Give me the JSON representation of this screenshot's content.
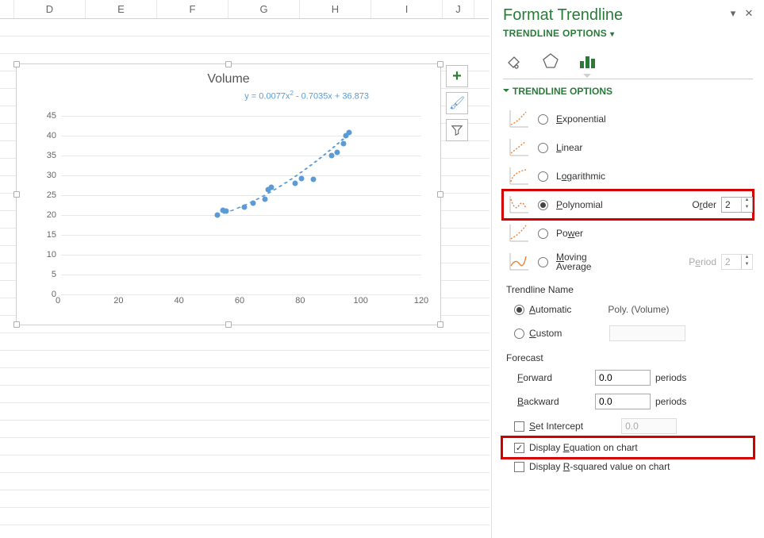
{
  "spreadsheet": {
    "columns": [
      "D",
      "E",
      "F",
      "G",
      "H",
      "I",
      "J"
    ]
  },
  "chart_floating_buttons": {
    "add": "+",
    "styles": "✎",
    "filter": "filter"
  },
  "chart_data": {
    "type": "scatter",
    "title": "Volume",
    "equation_prefix": "y = 0.0077x",
    "equation_mid": " - 0.7035x + 36.873",
    "equation_sup": "2",
    "xlim": [
      0,
      120
    ],
    "ylim": [
      0,
      45
    ],
    "xticks": [
      0,
      20,
      40,
      60,
      80,
      100,
      120
    ],
    "yticks": [
      0,
      5,
      10,
      15,
      20,
      25,
      30,
      35,
      40,
      45
    ],
    "x": [
      52,
      54,
      55,
      61,
      64,
      68,
      69,
      70,
      78,
      80,
      84,
      90,
      92,
      94,
      95,
      96
    ],
    "y": [
      20,
      21.2,
      21,
      22,
      23,
      24,
      26.5,
      27,
      28,
      29.3,
      29,
      35,
      35.8,
      38,
      40,
      40.8
    ],
    "trendline": {
      "type": "polynomial",
      "order": 2,
      "coeffs": [
        0.0077,
        -0.7035,
        36.873
      ]
    }
  },
  "pane": {
    "title": "Format Trendline",
    "subtitle": "TRENDLINE OPTIONS",
    "section": "TRENDLINE OPTIONS",
    "options": {
      "exponential": "Exponential",
      "linear": "Linear",
      "logarithmic": "Logarithmic",
      "polynomial": "Polynomial",
      "power": "Power",
      "moving": "Moving Average"
    },
    "order_label": "Order",
    "order_value": "2",
    "period_label": "Period",
    "period_value": "2",
    "name_h": "Trendline Name",
    "name_auto": "Automatic",
    "name_auto_value": "Poly. (Volume)",
    "name_custom": "Custom",
    "forecast_h": "Forecast",
    "forward_l": "Forward",
    "forward_v": "0.0",
    "backward_l": "Backward",
    "backward_v": "0.0",
    "periods_l": "periods",
    "set_intercept": "Set Intercept",
    "set_intercept_v": "0.0",
    "disp_eq": "Display Equation on chart",
    "disp_r2": "Display R-squared value on chart"
  }
}
